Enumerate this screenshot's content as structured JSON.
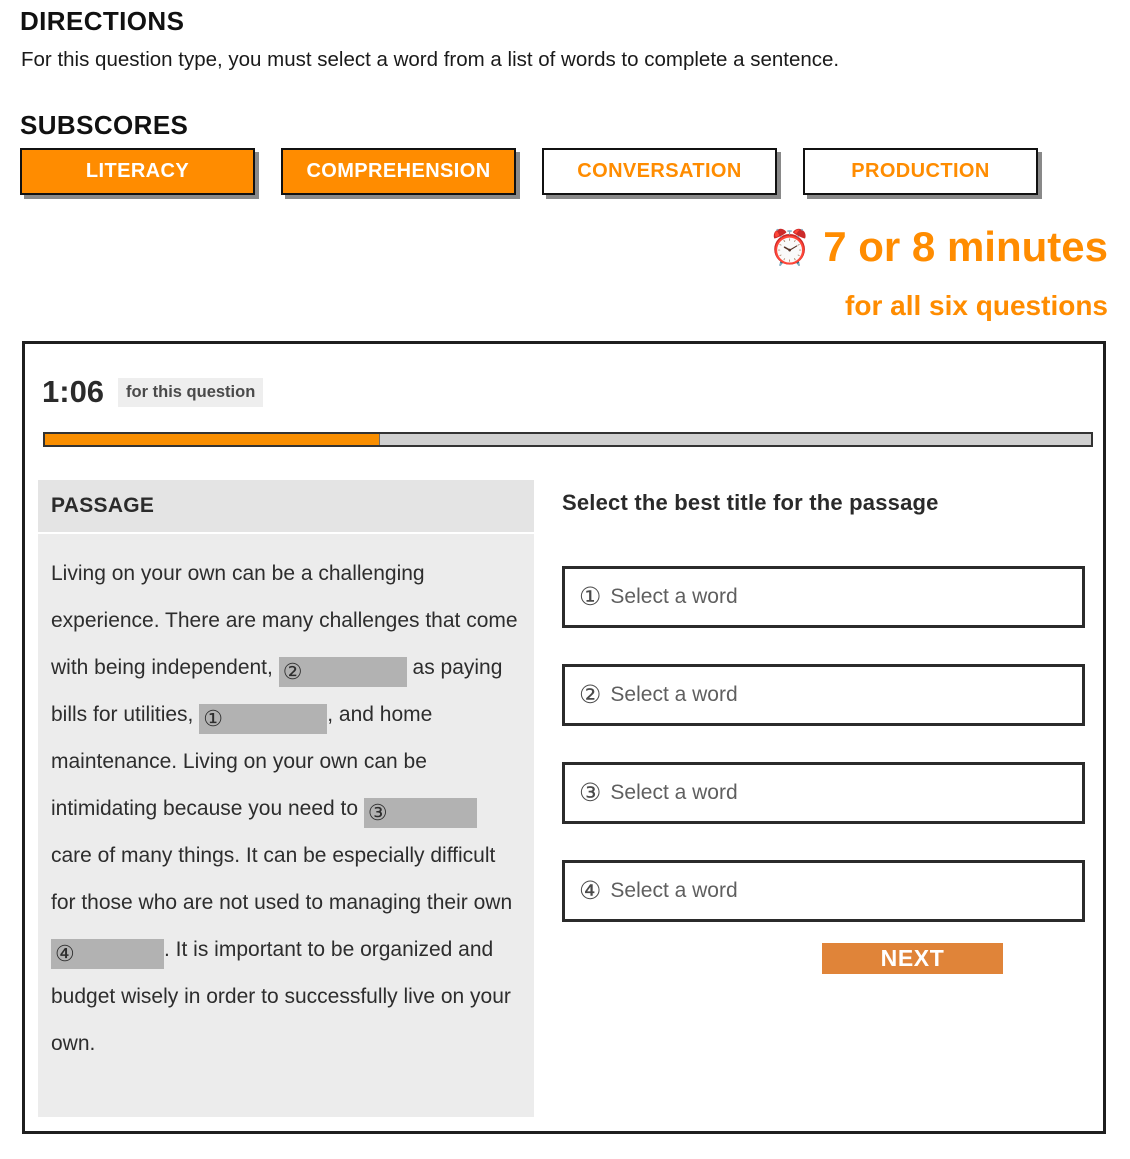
{
  "directions": {
    "heading": "DIRECTIONS",
    "body": "For this question type, you must select a word from a list of words to complete a sentence."
  },
  "subscores": {
    "heading": "SUBSCORES",
    "chips": [
      {
        "label": "LITERACY",
        "state": "selected"
      },
      {
        "label": "COMPREHENSION",
        "state": "selected"
      },
      {
        "label": "CONVERSATION",
        "state": "unselected"
      },
      {
        "label": "PRODUCTION",
        "state": "unselected"
      }
    ]
  },
  "callout": {
    "icon": "alarm-clock-icon",
    "icon_glyph": "⏰",
    "main": "7 or 8 minutes",
    "sub": "for all six questions",
    "accent_color": "#FF8C00"
  },
  "panel": {
    "timer": {
      "value": "1:06",
      "label": "for this question",
      "progress_percent": 32,
      "fill_color": "#F98E00",
      "track_color": "#d0d0d0"
    },
    "passage": {
      "header": "PASSAGE",
      "blank_color": "#b2b2b2",
      "segments": [
        {
          "type": "text",
          "text": "Living on your own can be a challenging experience. There are many challenges that come with being independent, "
        },
        {
          "type": "blank",
          "number": "②",
          "width": "w1"
        },
        {
          "type": "text",
          "text": " as paying bills for utilities, "
        },
        {
          "type": "blank",
          "number": "①",
          "width": "w2"
        },
        {
          "type": "text",
          "text": ", and home maintenance. Living on your own can be intimidating because you need to "
        },
        {
          "type": "blank",
          "number": "③",
          "width": "w3"
        },
        {
          "type": "text",
          "text": " care of many things. It can be especially difficult for those who are not used to managing their own "
        },
        {
          "type": "blank",
          "number": "④",
          "width": "w4"
        },
        {
          "type": "text",
          "text": ". It is important to be organized and budget wisely in order to successfully live on your own."
        }
      ]
    },
    "question": {
      "prompt": "Select the best title for the passage",
      "options": [
        {
          "number": "①",
          "label": "Select a word"
        },
        {
          "number": "②",
          "label": "Select a word"
        },
        {
          "number": "③",
          "label": "Select a word"
        },
        {
          "number": "④",
          "label": "Select a word"
        }
      ],
      "next_label": "NEXT",
      "next_color": "#e08439"
    }
  }
}
